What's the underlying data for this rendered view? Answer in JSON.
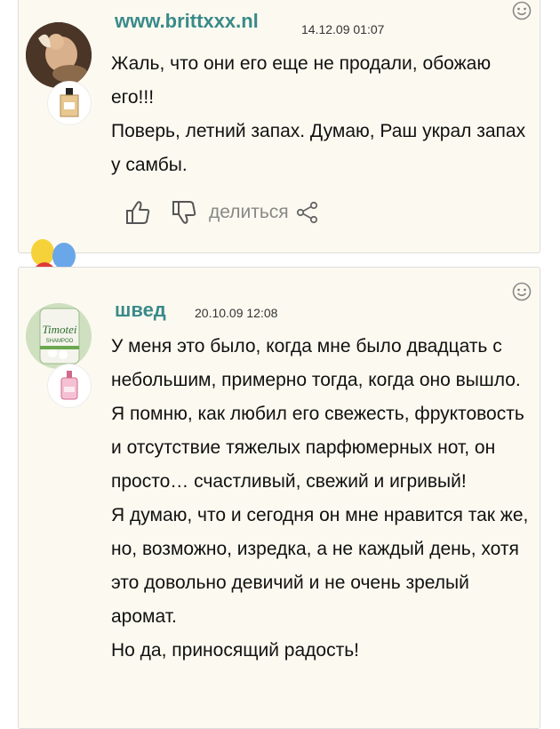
{
  "comments": [
    {
      "username": "www.brittxxx.nl",
      "date": "14.12.09 01:07",
      "paragraphs": [
        "Жаль, что они его еще не продали, обожаю его!!!",
        "Поверь, летний запах. Думаю, Раш украл запах у самбы."
      ],
      "share_label": "делиться"
    },
    {
      "username": "швед",
      "date": "20.10.09 12:08",
      "avatar_brand": "Timotei",
      "avatar_subtext": "SHAMPOO",
      "paragraphs": [
        "У меня это было, когда мне было двадцать с небольшим, примерно тогда, когда оно вышло. Я помню, как любил его свежесть, фруктовость и отсутствие тяжелых парфюмерных нот, он просто… счастливый, свежий и игривый!",
        "Я думаю, что и сегодня он мне нравится так же, но, возможно, изредка, а не каждый день, хотя это довольно девичий и не очень зрелый аромат.",
        "Но да, приносящий радость!"
      ]
    }
  ],
  "colors": {
    "username": "#3a8a8a",
    "card_bg": "#fcfaf0",
    "icon": "#555555"
  },
  "icons": [
    "smile-icon",
    "thumbs-up-icon",
    "thumbs-down-icon",
    "share-icon",
    "balloons-icon"
  ]
}
